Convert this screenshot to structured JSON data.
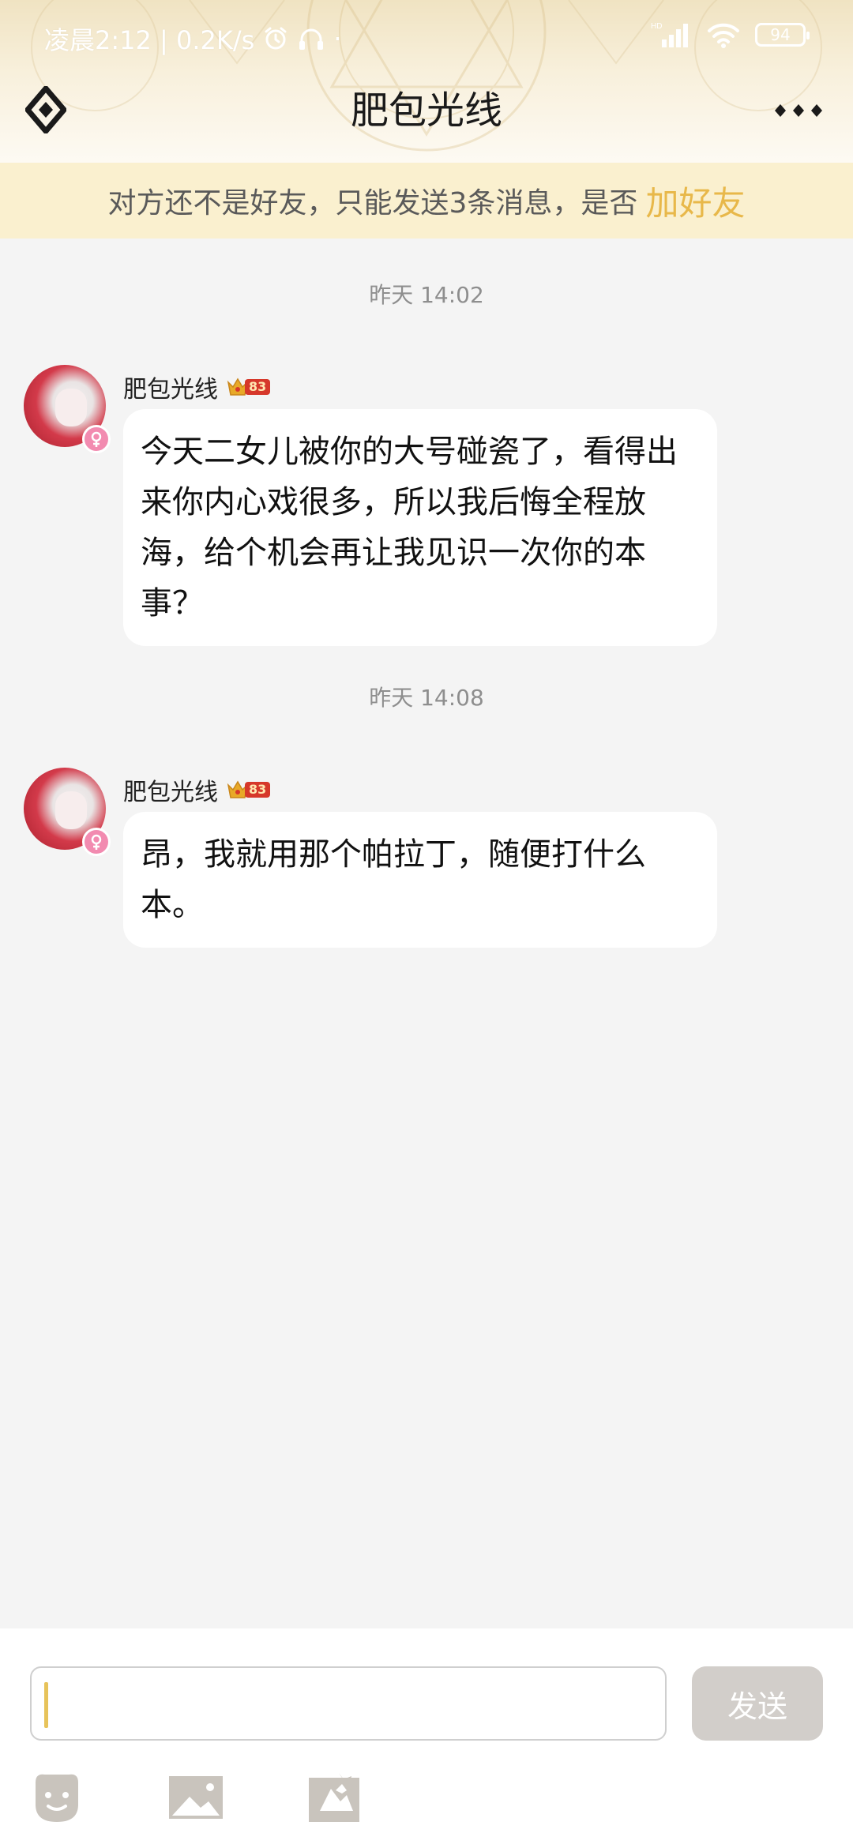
{
  "status_bar": {
    "time_speed": "凌晨2:12 | 0.2K/s",
    "battery": "94",
    "dot": "·",
    "hd": "HD"
  },
  "header": {
    "title": "肥包光线"
  },
  "banner": {
    "text": "对方还不是好友，只能发送3条消息，是否",
    "link": "加好友"
  },
  "messages": [
    {
      "timestamp": "昨天   14:02",
      "sender": "肥包光线",
      "level": "83",
      "text": "今天二女儿被你的大号碰瓷了，看得出来你内心戏很多，所以我后悔全程放海，给个机会再让我见识一次你的本事？"
    },
    {
      "timestamp": "昨天   14:08",
      "sender": "肥包光线",
      "level": "83",
      "text": "昂，我就用那个帕拉丁，随便打什么本。"
    }
  ],
  "input": {
    "value": "",
    "send_label": "发送"
  },
  "icons": {
    "back": "diamond-back-icon",
    "more": "more-dots-icon",
    "emoji": "face-icon",
    "image": "image-icon",
    "sticker": "sticker-icon"
  },
  "colors": {
    "accent": "#e8b84a",
    "banner_bg": "#faf0cf",
    "chat_bg": "#f4f4f4",
    "send_button": "#d2ceca"
  }
}
